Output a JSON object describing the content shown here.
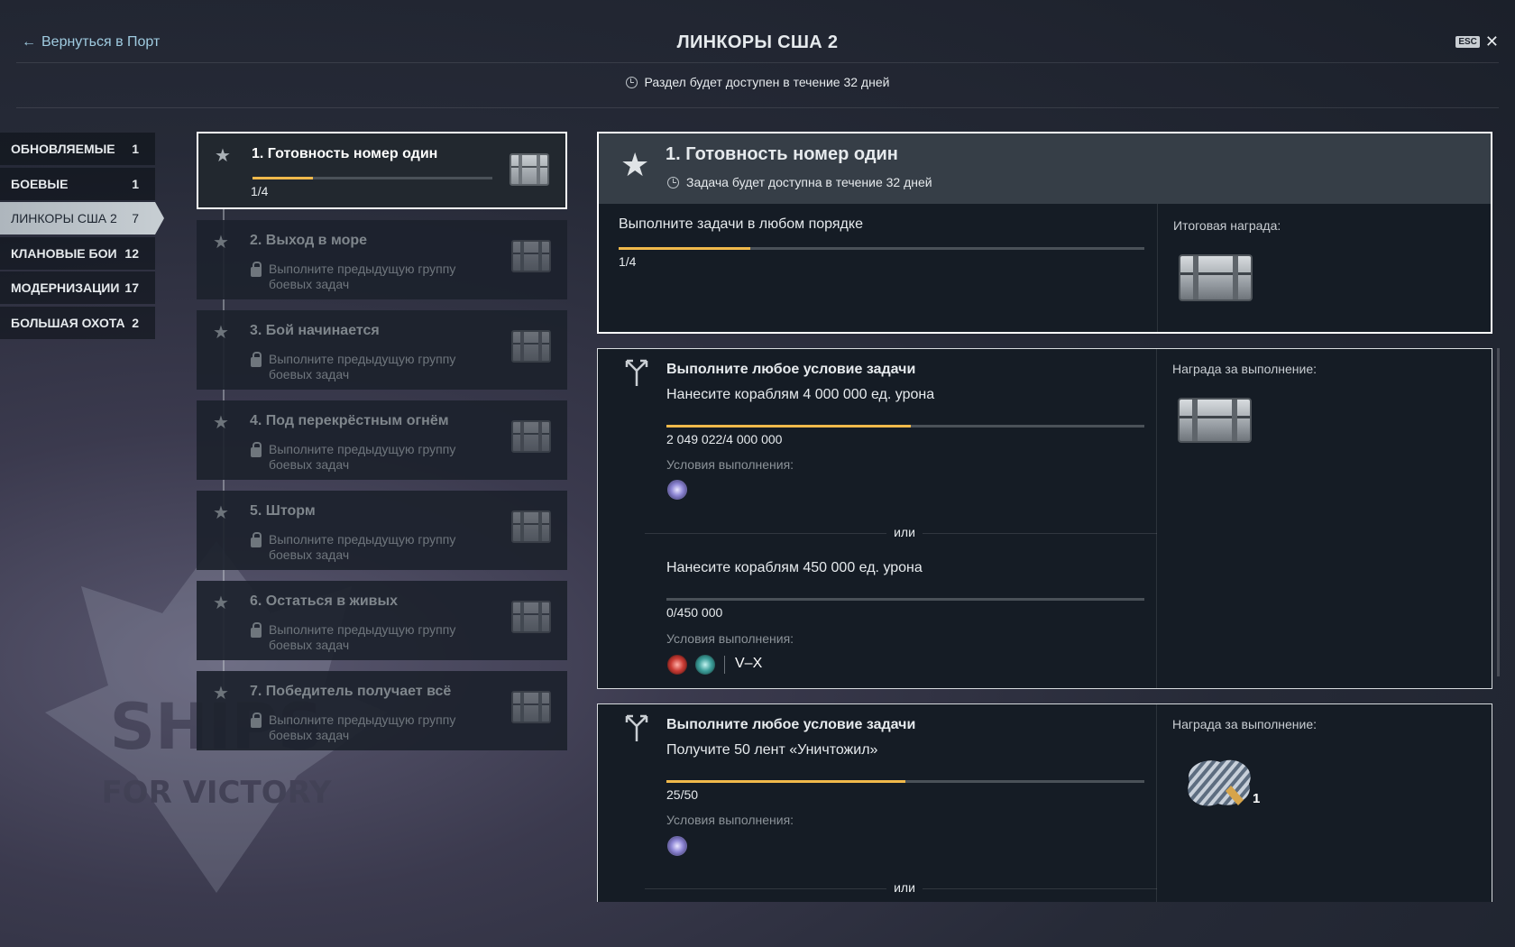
{
  "header": {
    "back_label": "Вернуться в Порт",
    "title": "ЛИНКОРЫ США 2",
    "esc_label": "ESC",
    "close_symbol": "✕",
    "availability": "Раздел будет доступен в течение 32 дней"
  },
  "categories": [
    {
      "label": "ОБНОВЛЯЕМЫЕ",
      "count": "1"
    },
    {
      "label": "БОЕВЫЕ",
      "count": "1"
    },
    {
      "label": "ЛИНКОРЫ США 2",
      "count": "7",
      "active": true
    },
    {
      "label": "КЛАНОВЫЕ БОИ",
      "count": "12"
    },
    {
      "label": "МОДЕРНИЗАЦИИ",
      "count": "17"
    },
    {
      "label": "БОЛЬШАЯ ОХОТА",
      "count": "2"
    }
  ],
  "groups": [
    {
      "title": "1. Готовность номер один",
      "progress_text": "1/4",
      "progress": 0.25
    },
    {
      "title": "2. Выход в море",
      "locked_text": "Выполните предыдущую группу боевых задач"
    },
    {
      "title": "3. Бой начинается",
      "locked_text": "Выполните предыдущую группу боевых задач"
    },
    {
      "title": "4. Под перекрёстным огнём",
      "locked_text": "Выполните предыдущую группу боевых задач"
    },
    {
      "title": "5. Шторм",
      "locked_text": "Выполните предыдущую группу боевых задач"
    },
    {
      "title": "6. Остаться в живых",
      "locked_text": "Выполните предыдущую группу боевых задач"
    },
    {
      "title": "7. Победитель получает всё",
      "locked_text": "Выполните предыдущую группу боевых задач"
    }
  ],
  "detail": {
    "title": "1. Готовность номер один",
    "availability": "Задача будет доступна в течение 32 дней",
    "instruction": "Выполните задачи в любом порядке",
    "progress_text": "1/4",
    "progress": 0.25,
    "final_reward_label": "Итоговая награда:"
  },
  "tasks": [
    {
      "heading": "Выполните любое условие задачи",
      "reward_label": "Награда за выполнение:",
      "or_label": "или",
      "conditions": [
        {
          "text": "Нанесите кораблям 4 000 000 ед. урона",
          "count": "2 049 022/4 000 000",
          "progress": 0.512,
          "cond_label": "Условия выполнения:"
        },
        {
          "text": "Нанесите кораблям 450 000 ед. урона",
          "count": "0/450 000",
          "progress": 0,
          "cond_label": "Условия выполнения:",
          "tier": "V–X"
        }
      ]
    },
    {
      "heading": "Выполните любое условие задачи",
      "reward_label": "Награда за выполнение:",
      "or_label": "или",
      "reward_count": "1",
      "conditions": [
        {
          "text": "Получите 50 лент «Уничтожил»",
          "count": "25/50",
          "progress": 0.5,
          "cond_label": "Условия выполнения:"
        }
      ]
    }
  ],
  "colors": {
    "accent": "#f0b94b",
    "active_border": "#ffffff",
    "active_tab": "#c6cdd2"
  },
  "icons": [
    "back-arrow-icon",
    "clock-icon",
    "star-icon",
    "lock-icon",
    "chest-icon",
    "branch-icon",
    "camouflage-icon",
    "close-icon"
  ]
}
